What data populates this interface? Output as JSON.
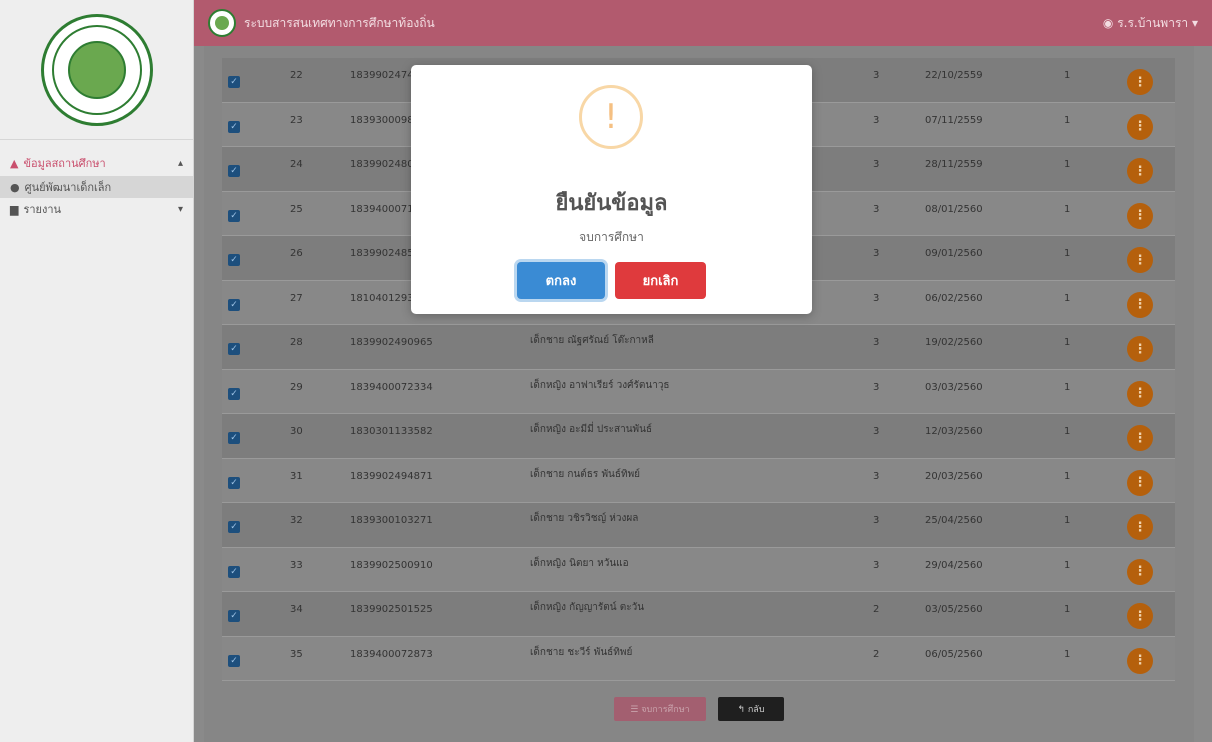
{
  "app": {
    "title": "ระบบสารสนเทศทางการศึกษาท้องถิ่น",
    "user": "ร.ร.บ้านพารา",
    "user_caret": "▾"
  },
  "sidebar": {
    "items": [
      {
        "label": "ข้อมูลสถานศึกษา",
        "icon": "graduation-cap-icon",
        "chevron": "▴"
      },
      {
        "label": "ศูนย์พัฒนาเด็กเล็ก",
        "icon": "bullet-icon"
      },
      {
        "label": "รายงาน",
        "icon": "document-icon",
        "chevron": "▾"
      }
    ]
  },
  "table": {
    "rows": [
      {
        "no": "22",
        "id": "183990247470",
        "name": "",
        "level": "3",
        "date": "22/10/2559",
        "term": "1"
      },
      {
        "no": "23",
        "id": "183930009830",
        "name": "",
        "level": "3",
        "date": "07/11/2559",
        "term": "1"
      },
      {
        "no": "24",
        "id": "183990248000",
        "name": "",
        "level": "3",
        "date": "28/11/2559",
        "term": "1"
      },
      {
        "no": "25",
        "id": "183940007170",
        "name": "",
        "level": "3",
        "date": "08/01/2560",
        "term": "1"
      },
      {
        "no": "26",
        "id": "183990248550",
        "name": "",
        "level": "3",
        "date": "09/01/2560",
        "term": "1"
      },
      {
        "no": "27",
        "id": "181040129397",
        "name": "",
        "level": "3",
        "date": "06/02/2560",
        "term": "1"
      },
      {
        "no": "28",
        "id": "1839902490965",
        "name": "เด็กชาย ณัฐศรัณย์ โต๊ะกาหลี",
        "level": "3",
        "date": "19/02/2560",
        "term": "1"
      },
      {
        "no": "29",
        "id": "1839400072334",
        "name": "เด็กหญิง อาฟาเรียร์ วงศ์รัตนาวุธ",
        "level": "3",
        "date": "03/03/2560",
        "term": "1"
      },
      {
        "no": "30",
        "id": "1830301133582",
        "name": "เด็กหญิง อะมีมี่ ประสานพันธ์",
        "level": "3",
        "date": "12/03/2560",
        "term": "1"
      },
      {
        "no": "31",
        "id": "1839902494871",
        "name": "เด็กชาย กนต์ธร พันธ์ทิพย์",
        "level": "3",
        "date": "20/03/2560",
        "term": "1"
      },
      {
        "no": "32",
        "id": "1839300103271",
        "name": "เด็กชาย วชิรวิชญ์ ห่วงผล",
        "level": "3",
        "date": "25/04/2560",
        "term": "1"
      },
      {
        "no": "33",
        "id": "1839902500910",
        "name": "เด็กหญิง นิตยา หวันแอ",
        "level": "3",
        "date": "29/04/2560",
        "term": "1"
      },
      {
        "no": "34",
        "id": "1839902501525",
        "name": "เด็กหญิง กัญญารัตน์ ตะวัน",
        "level": "2",
        "date": "03/05/2560",
        "term": "1"
      },
      {
        "no": "35",
        "id": "1839400072873",
        "name": "เด็กชาย ชะวีร์ พันธ์ทิพย์",
        "level": "2",
        "date": "06/05/2560",
        "term": "1"
      }
    ]
  },
  "actions": {
    "finish_label": "☰ จบการศึกษา",
    "back_label": "↰ กลับ"
  },
  "modal": {
    "icon_glyph": "!",
    "title": "ยืนยันข้อมูล",
    "text": "จบการศึกษา",
    "ok_label": "ตกลง",
    "cancel_label": "ยกเลิก"
  }
}
